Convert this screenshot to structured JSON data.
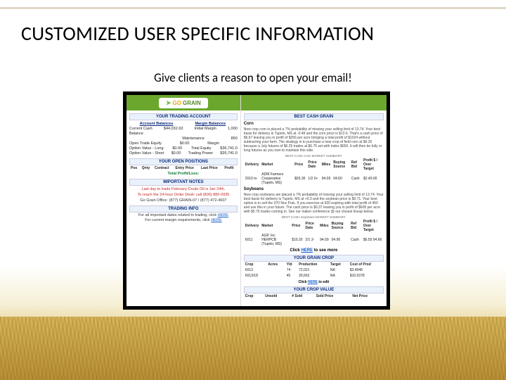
{
  "slide": {
    "title": "CUSTOMIZED USER SPECIFIC INFORMATION",
    "subtitle": "Give clients a reason to open your email!"
  },
  "logo": {
    "go": "GO",
    "grain": "GRAIN"
  },
  "left": {
    "trading_account": {
      "header": "YOUR TRADING ACCOUNT",
      "col_balances": "Account Balances",
      "col_margins": "Margin Balances",
      "rows": [
        {
          "l": "Current Cash",
          "lv": "$44,032.63",
          "r": "Initial Margin",
          "rv": "1,000"
        },
        {
          "l": "Balance",
          "lv": "",
          "r": "",
          "rv": ""
        },
        {
          "l": "",
          "lv": "",
          "r": "Maintenance",
          "rv": "850"
        },
        {
          "l": "Open Trade Equity",
          "lv": "$0.00",
          "r": "Margin",
          "rv": ""
        },
        {
          "l": "Option Value - Long",
          "lv": "$0.00",
          "r": "Total Equity",
          "rv": "$36,741.0"
        },
        {
          "l": "Option Value - Short",
          "lv": "$0.00",
          "r": "Trading Power",
          "rv": "$35,741.0"
        }
      ]
    },
    "open_positions": {
      "header": "YOUR OPEN POSITIONS",
      "cols": [
        "Pos",
        "Qnty",
        "Contract",
        "Entry Price",
        "Last Price",
        "Profit"
      ],
      "total": "Total Profit/Loss:"
    },
    "important": {
      "header": "IMPORTANT NOTES",
      "line1": "Last day to trade February Crude Oil is Jan 24th.",
      "line2_html": "To reach the 24-hour Order Desk: call (800) 880-0935",
      "line3": "Go Grain Office: (877) GRAIN-07 / (877) 472-4607"
    },
    "trading_info": {
      "header": "TRADING INFO",
      "line1_pre": "For all important dates related to trading, click ",
      "here": "HERE",
      "line2_pre": "For current margin requirements, click ",
      "here2": "HERE"
    }
  },
  "right": {
    "cash_grain_header": "BEST CASH GRAIN",
    "click_more_pre": "Click ",
    "click_more_mid": "HERE",
    "click_more_post": " to see more",
    "corn": {
      "label": "Corn",
      "para": "New crop corn is placed a 7% probability of missing your selling limit of 13.74. Your best basis for delivery is Tupelo, MS at -0.48 and the corn price is $12.6. That's a cash price of $6.67 leaving you in profit of $256 per acre bringing a total profit of $1024 without subtracting your farm. The strategy is to purchase a new crop of field corn at $6.25 because a July futures of $6.25 trades at $6.75 set with index $655. It will then be fully or long futures as you own to maintain this side.",
      "summary_label": "BEST CASH Corn MARKET SUMMARY",
      "th": [
        "Delivery",
        "Market",
        "Price",
        "Price Date",
        "Miles",
        "Buying Source",
        "Ref Bid",
        "Profit $ / Over Target"
      ],
      "row": [
        "2010 to",
        "ADM Farmers Cooperative (Tupelo, MS)",
        "$03.30",
        "1/2 0+",
        "94.09",
        "04.60",
        "Cash",
        "$2.49.00"
      ]
    },
    "soy": {
      "label": "Soybeans",
      "para": "New crop soybeans are placed a 7% probability of missing your selling limit of 13.74. Your best basis for delivery is Tupelo, MS at +0.3 and the soybean price is $9.71. Your best option is to sell the 970 Nov Puts. If you exercise at 920 expiring with total profit of 450 and use this in your future. The cash price is $9.37 leaving you in profit of $605 per acre with $5.75 trades coming in. See our maker conference @ our closest lineup below.",
      "summary_label": "BEST CASH Soybeans MARKET SUMMARY",
      "th": [
        "Delivery",
        "Market",
        "Price",
        "Price Date",
        "Miles",
        "Buying Source",
        "Ref Bid",
        "Profit $ / Over Target"
      ],
      "row": [
        "6011",
        "AGP, Inc HERPCB (Tupelo, MS)",
        "$10.20",
        "2/1 3-",
        "94.09",
        "04.90",
        "Cash",
        "$6.55 94.66"
      ]
    },
    "grain_crop": {
      "header": "YOUR GRAIN CROP",
      "cols": [
        "Crop",
        "Acres",
        "Yld",
        "Production",
        "Target",
        "Cost of Prod"
      ],
      "rows": [
        [
          "6013",
          "",
          "74",
          "72,021",
          "NA",
          "$3.4948"
        ],
        [
          "6013/18",
          "",
          "45",
          "26,662",
          "NA",
          "$10.0378"
        ]
      ],
      "click_pre": "Click ",
      "click_mid": "HERE",
      "click_post": " to edit"
    },
    "crop_value": {
      "header": "YOUR CROP VALUE",
      "cols": [
        "Crop",
        "Unsold",
        "# Sold",
        "Sold Price",
        "Net Price"
      ]
    }
  }
}
